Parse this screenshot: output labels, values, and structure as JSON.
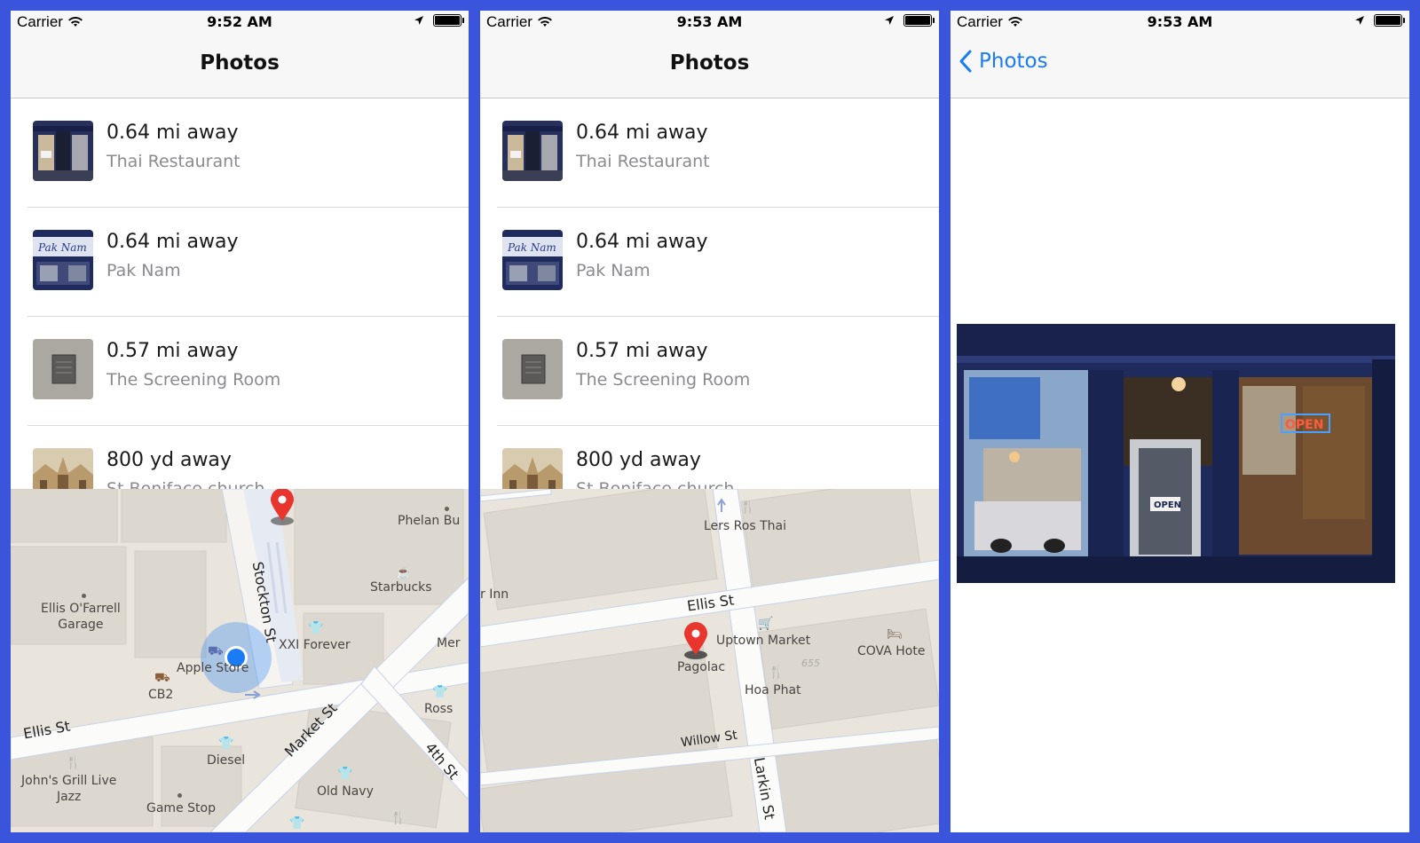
{
  "status": {
    "carrier": "Carrier",
    "times": [
      "9:52 AM",
      "9:53 AM",
      "9:53 AM"
    ]
  },
  "nav": {
    "title": "Photos",
    "back_label": "Photos"
  },
  "rows": [
    {
      "distance": "0.64 mi away",
      "name": "Thai Restaurant"
    },
    {
      "distance": "0.64 mi away",
      "name": "Pak Nam"
    },
    {
      "distance": "0.57 mi away",
      "name": "The Screening Room"
    },
    {
      "distance": "800 yd away",
      "name": "St Boniface church"
    }
  ],
  "map1": {
    "places": {
      "phelan": "Phelan Bu",
      "starbucks": "Starbucks",
      "ellis_garage": "Ellis O'Farrell\nGarage",
      "xxi": "XXI Forever",
      "mer": "Mer",
      "apple": "Apple Store",
      "cb2": "CB2",
      "ross": "Ross",
      "diesel": "Diesel",
      "johns": "John's Grill Live\nJazz",
      "old_navy": "Old Navy",
      "game_stop": "Game Stop"
    },
    "streets": {
      "stockton": "Stockton St",
      "ellis": "Ellis St",
      "market": "Market St",
      "fourth": "4th St"
    }
  },
  "map2": {
    "places": {
      "lers": "Lers Ros Thai",
      "inn": "r Inn",
      "uptown": "Uptown Market",
      "cova": "COVA Hote",
      "pagolac": "Pagolac",
      "hoa": "Hoa Phat",
      "num": "655"
    },
    "streets": {
      "ellis": "Ellis St",
      "willow": "Willow St",
      "larkin": "Larkin St"
    }
  },
  "colors": {
    "accent": "#1a7cf5",
    "frame": "#3a55dc",
    "pin": "#e8362e",
    "location": "#1a7cf5"
  }
}
